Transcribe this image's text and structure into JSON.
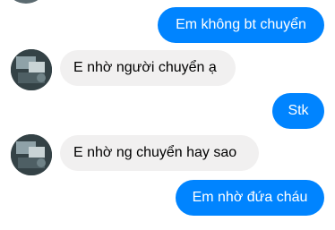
{
  "conversation": {
    "messages": [
      {
        "sender": "self",
        "text": "Em không bt chuyển"
      },
      {
        "sender": "contact",
        "text": "E nhờ người chuyển ạ"
      },
      {
        "sender": "self",
        "text": "Stk"
      },
      {
        "sender": "contact",
        "text": "E nhờ ng chuyển hay sao"
      },
      {
        "sender": "self",
        "text": "Em nhờ đứa cháu"
      },
      {
        "sender": "contact",
        "text": ""
      }
    ]
  },
  "colors": {
    "outgoing_bubble": "#0084ff",
    "incoming_bubble": "#f1f0f0",
    "outgoing_text": "#ffffff",
    "incoming_text": "#000000"
  },
  "icons": {
    "contact_avatar": "contact-avatar-photo"
  }
}
